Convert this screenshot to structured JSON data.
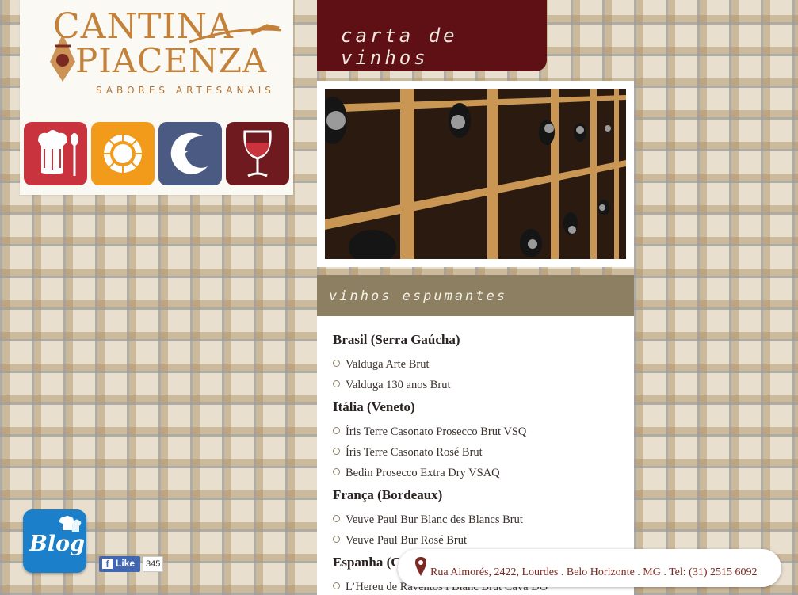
{
  "brand": {
    "logo_line1": "CANTINA",
    "logo_line2": "PIACENZA",
    "tagline": "SABORES ARTESANAIS"
  },
  "nav_icons": [
    {
      "icon": "chef-hat-spoon-icon",
      "color": "#c8333d"
    },
    {
      "icon": "sun-icon",
      "color": "#f29a1a"
    },
    {
      "icon": "moon-star-icon",
      "color": "#4a5a82"
    },
    {
      "icon": "wine-glass-icon",
      "color": "#6e1a1f"
    }
  ],
  "page": {
    "title": "carta de vinhos",
    "section_title": "vinhos espumantes"
  },
  "wine_list": [
    {
      "region": "Brasil (Serra Gaúcha)",
      "wines": [
        "Valduga Arte Brut",
        "Valduga 130 anos Brut"
      ]
    },
    {
      "region": "Itália (Veneto)",
      "wines": [
        "Íris Terre Casonato Prosecco Brut VSQ",
        "Íris Terre Casonato Rosé Brut",
        "Bedin Prosecco Extra Dry VSAQ"
      ]
    },
    {
      "region": "França (Bordeaux)",
      "wines": [
        "Veuve Paul Bur Blanc des Blancs Brut",
        "Veuve Paul Bur Rosé Brut"
      ]
    },
    {
      "region": "Espanha (C",
      "wines": [
        "L’Hereu de Raventós i Blanc Brut Cava DO"
      ]
    }
  ],
  "social": {
    "blog_label": "Blog",
    "like_label": "Like",
    "like_count": "345"
  },
  "footer": {
    "address": "Rua Aimorés, 2422, Lourdes . Belo Horizonte . MG . Tel: (31) 2515 6092"
  },
  "colors": {
    "accent_wine": "#5e1015",
    "section_bar": "#8c7f62",
    "logo_orange": "#c4813a"
  }
}
